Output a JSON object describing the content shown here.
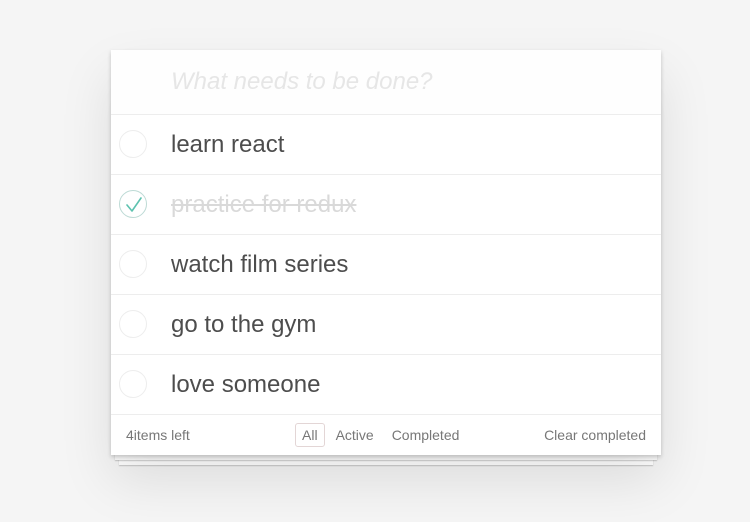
{
  "new_todo": {
    "placeholder": "What needs to be done?"
  },
  "todos": [
    {
      "label": "learn react",
      "completed": false
    },
    {
      "label": "practice for redux",
      "completed": true
    },
    {
      "label": "watch film series",
      "completed": false
    },
    {
      "label": "go to the gym",
      "completed": false
    },
    {
      "label": "love someone",
      "completed": false
    }
  ],
  "footer": {
    "count_text": "4items left",
    "filters": [
      {
        "label": "All",
        "selected": true
      },
      {
        "label": "Active",
        "selected": false
      },
      {
        "label": "Completed",
        "selected": false
      }
    ],
    "clear_label": "Clear completed"
  },
  "colors": {
    "background": "#f5f5f5",
    "text": "#4d4d4d",
    "completed_text": "#d9d9d9",
    "checkmark": "#5dc2af",
    "placeholder": "#e6e6e6"
  },
  "icons": {
    "unchecked": "empty-circle-icon",
    "checked": "checkmark-circle-icon"
  }
}
